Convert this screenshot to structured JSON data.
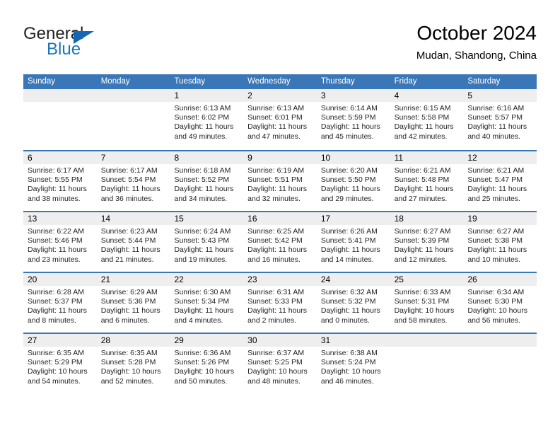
{
  "brand": {
    "name_top": "General",
    "name_bottom": "Blue",
    "accent_color": "#1b75bc",
    "triangle_color": "#1268b3"
  },
  "header": {
    "title": "October 2024",
    "location": "Mudan, Shandong, China"
  },
  "theme": {
    "header_blue": "#3a77b8",
    "day_band_gray": "#eeeeee",
    "text_color": "#000000"
  },
  "weekdays": [
    "Sunday",
    "Monday",
    "Tuesday",
    "Wednesday",
    "Thursday",
    "Friday",
    "Saturday"
  ],
  "weeks": [
    [
      {
        "day": "",
        "sunrise": "",
        "sunset": "",
        "daylight_line1": "",
        "daylight_line2": ""
      },
      {
        "day": "",
        "sunrise": "",
        "sunset": "",
        "daylight_line1": "",
        "daylight_line2": ""
      },
      {
        "day": "1",
        "sunrise": "Sunrise: 6:13 AM",
        "sunset": "Sunset: 6:02 PM",
        "daylight_line1": "Daylight: 11 hours",
        "daylight_line2": "and 49 minutes."
      },
      {
        "day": "2",
        "sunrise": "Sunrise: 6:13 AM",
        "sunset": "Sunset: 6:01 PM",
        "daylight_line1": "Daylight: 11 hours",
        "daylight_line2": "and 47 minutes."
      },
      {
        "day": "3",
        "sunrise": "Sunrise: 6:14 AM",
        "sunset": "Sunset: 5:59 PM",
        "daylight_line1": "Daylight: 11 hours",
        "daylight_line2": "and 45 minutes."
      },
      {
        "day": "4",
        "sunrise": "Sunrise: 6:15 AM",
        "sunset": "Sunset: 5:58 PM",
        "daylight_line1": "Daylight: 11 hours",
        "daylight_line2": "and 42 minutes."
      },
      {
        "day": "5",
        "sunrise": "Sunrise: 6:16 AM",
        "sunset": "Sunset: 5:57 PM",
        "daylight_line1": "Daylight: 11 hours",
        "daylight_line2": "and 40 minutes."
      }
    ],
    [
      {
        "day": "6",
        "sunrise": "Sunrise: 6:17 AM",
        "sunset": "Sunset: 5:55 PM",
        "daylight_line1": "Daylight: 11 hours",
        "daylight_line2": "and 38 minutes."
      },
      {
        "day": "7",
        "sunrise": "Sunrise: 6:17 AM",
        "sunset": "Sunset: 5:54 PM",
        "daylight_line1": "Daylight: 11 hours",
        "daylight_line2": "and 36 minutes."
      },
      {
        "day": "8",
        "sunrise": "Sunrise: 6:18 AM",
        "sunset": "Sunset: 5:52 PM",
        "daylight_line1": "Daylight: 11 hours",
        "daylight_line2": "and 34 minutes."
      },
      {
        "day": "9",
        "sunrise": "Sunrise: 6:19 AM",
        "sunset": "Sunset: 5:51 PM",
        "daylight_line1": "Daylight: 11 hours",
        "daylight_line2": "and 32 minutes."
      },
      {
        "day": "10",
        "sunrise": "Sunrise: 6:20 AM",
        "sunset": "Sunset: 5:50 PM",
        "daylight_line1": "Daylight: 11 hours",
        "daylight_line2": "and 29 minutes."
      },
      {
        "day": "11",
        "sunrise": "Sunrise: 6:21 AM",
        "sunset": "Sunset: 5:48 PM",
        "daylight_line1": "Daylight: 11 hours",
        "daylight_line2": "and 27 minutes."
      },
      {
        "day": "12",
        "sunrise": "Sunrise: 6:21 AM",
        "sunset": "Sunset: 5:47 PM",
        "daylight_line1": "Daylight: 11 hours",
        "daylight_line2": "and 25 minutes."
      }
    ],
    [
      {
        "day": "13",
        "sunrise": "Sunrise: 6:22 AM",
        "sunset": "Sunset: 5:46 PM",
        "daylight_line1": "Daylight: 11 hours",
        "daylight_line2": "and 23 minutes."
      },
      {
        "day": "14",
        "sunrise": "Sunrise: 6:23 AM",
        "sunset": "Sunset: 5:44 PM",
        "daylight_line1": "Daylight: 11 hours",
        "daylight_line2": "and 21 minutes."
      },
      {
        "day": "15",
        "sunrise": "Sunrise: 6:24 AM",
        "sunset": "Sunset: 5:43 PM",
        "daylight_line1": "Daylight: 11 hours",
        "daylight_line2": "and 19 minutes."
      },
      {
        "day": "16",
        "sunrise": "Sunrise: 6:25 AM",
        "sunset": "Sunset: 5:42 PM",
        "daylight_line1": "Daylight: 11 hours",
        "daylight_line2": "and 16 minutes."
      },
      {
        "day": "17",
        "sunrise": "Sunrise: 6:26 AM",
        "sunset": "Sunset: 5:41 PM",
        "daylight_line1": "Daylight: 11 hours",
        "daylight_line2": "and 14 minutes."
      },
      {
        "day": "18",
        "sunrise": "Sunrise: 6:27 AM",
        "sunset": "Sunset: 5:39 PM",
        "daylight_line1": "Daylight: 11 hours",
        "daylight_line2": "and 12 minutes."
      },
      {
        "day": "19",
        "sunrise": "Sunrise: 6:27 AM",
        "sunset": "Sunset: 5:38 PM",
        "daylight_line1": "Daylight: 11 hours",
        "daylight_line2": "and 10 minutes."
      }
    ],
    [
      {
        "day": "20",
        "sunrise": "Sunrise: 6:28 AM",
        "sunset": "Sunset: 5:37 PM",
        "daylight_line1": "Daylight: 11 hours",
        "daylight_line2": "and 8 minutes."
      },
      {
        "day": "21",
        "sunrise": "Sunrise: 6:29 AM",
        "sunset": "Sunset: 5:36 PM",
        "daylight_line1": "Daylight: 11 hours",
        "daylight_line2": "and 6 minutes."
      },
      {
        "day": "22",
        "sunrise": "Sunrise: 6:30 AM",
        "sunset": "Sunset: 5:34 PM",
        "daylight_line1": "Daylight: 11 hours",
        "daylight_line2": "and 4 minutes."
      },
      {
        "day": "23",
        "sunrise": "Sunrise: 6:31 AM",
        "sunset": "Sunset: 5:33 PM",
        "daylight_line1": "Daylight: 11 hours",
        "daylight_line2": "and 2 minutes."
      },
      {
        "day": "24",
        "sunrise": "Sunrise: 6:32 AM",
        "sunset": "Sunset: 5:32 PM",
        "daylight_line1": "Daylight: 11 hours",
        "daylight_line2": "and 0 minutes."
      },
      {
        "day": "25",
        "sunrise": "Sunrise: 6:33 AM",
        "sunset": "Sunset: 5:31 PM",
        "daylight_line1": "Daylight: 10 hours",
        "daylight_line2": "and 58 minutes."
      },
      {
        "day": "26",
        "sunrise": "Sunrise: 6:34 AM",
        "sunset": "Sunset: 5:30 PM",
        "daylight_line1": "Daylight: 10 hours",
        "daylight_line2": "and 56 minutes."
      }
    ],
    [
      {
        "day": "27",
        "sunrise": "Sunrise: 6:35 AM",
        "sunset": "Sunset: 5:29 PM",
        "daylight_line1": "Daylight: 10 hours",
        "daylight_line2": "and 54 minutes."
      },
      {
        "day": "28",
        "sunrise": "Sunrise: 6:35 AM",
        "sunset": "Sunset: 5:28 PM",
        "daylight_line1": "Daylight: 10 hours",
        "daylight_line2": "and 52 minutes."
      },
      {
        "day": "29",
        "sunrise": "Sunrise: 6:36 AM",
        "sunset": "Sunset: 5:26 PM",
        "daylight_line1": "Daylight: 10 hours",
        "daylight_line2": "and 50 minutes."
      },
      {
        "day": "30",
        "sunrise": "Sunrise: 6:37 AM",
        "sunset": "Sunset: 5:25 PM",
        "daylight_line1": "Daylight: 10 hours",
        "daylight_line2": "and 48 minutes."
      },
      {
        "day": "31",
        "sunrise": "Sunrise: 6:38 AM",
        "sunset": "Sunset: 5:24 PM",
        "daylight_line1": "Daylight: 10 hours",
        "daylight_line2": "and 46 minutes."
      },
      {
        "day": "",
        "sunrise": "",
        "sunset": "",
        "daylight_line1": "",
        "daylight_line2": ""
      },
      {
        "day": "",
        "sunrise": "",
        "sunset": "",
        "daylight_line1": "",
        "daylight_line2": ""
      }
    ]
  ]
}
